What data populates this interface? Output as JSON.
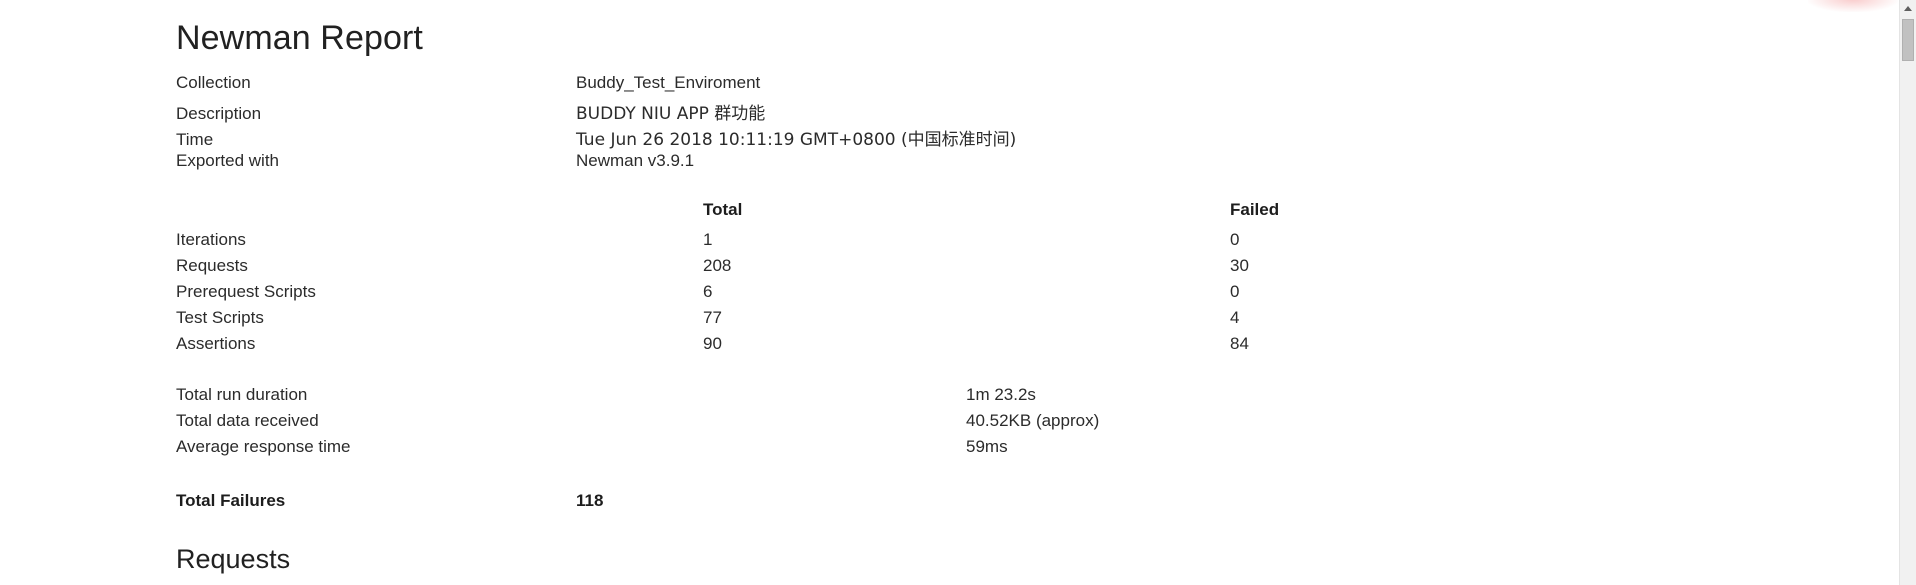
{
  "page": {
    "title": "Newman Report",
    "requests_section_heading": "Requests"
  },
  "meta": {
    "rows": [
      {
        "label": "Collection",
        "value": "Buddy_Test_Enviroment"
      },
      {
        "label": "Description",
        "value": "BUDDY NIU APP 群功能"
      },
      {
        "label": "Time",
        "value": "Tue Jun 26 2018 10:11:19 GMT+0800 (中国标准时间)"
      },
      {
        "label": "Exported with",
        "value": "Newman v3.9.1"
      }
    ]
  },
  "stats": {
    "columns": [
      "",
      "Total",
      "Failed"
    ],
    "rows": [
      {
        "label": "Iterations",
        "total": "1",
        "failed": "0"
      },
      {
        "label": "Requests",
        "total": "208",
        "failed": "30"
      },
      {
        "label": "Prerequest Scripts",
        "total": "6",
        "failed": "0"
      },
      {
        "label": "Test Scripts",
        "total": "77",
        "failed": "4"
      },
      {
        "label": "Assertions",
        "total": "90",
        "failed": "84"
      }
    ]
  },
  "summary": {
    "rows": [
      {
        "label": "Total run duration",
        "value": "1m 23.2s"
      },
      {
        "label": "Total data received",
        "value": "40.52KB (approx)"
      },
      {
        "label": "Average response time",
        "value": "59ms"
      }
    ]
  },
  "failures": {
    "label": "Total Failures",
    "value": "118"
  },
  "chart_data": {
    "type": "table",
    "title": "Newman Report run summary",
    "categories": [
      "Iterations",
      "Requests",
      "Prerequest Scripts",
      "Test Scripts",
      "Assertions"
    ],
    "series": [
      {
        "name": "Total",
        "values": [
          1,
          208,
          6,
          77,
          90
        ]
      },
      {
        "name": "Failed",
        "values": [
          0,
          30,
          0,
          4,
          84
        ]
      }
    ],
    "annotations": {
      "total_run_duration": "1m 23.2s",
      "total_data_received": "40.52KB (approx)",
      "average_response_time": "59ms",
      "total_failures": 118
    }
  },
  "colors": {
    "text": "#2b2b2b",
    "heading": "#212121",
    "scrollbar_track": "#f1f1f1",
    "scrollbar_thumb": "#c1c1c1"
  }
}
